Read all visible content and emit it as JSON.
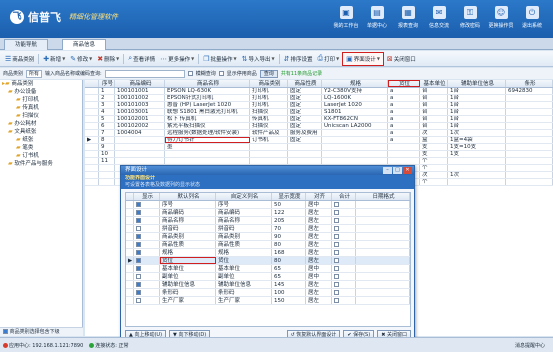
{
  "app": {
    "brand_name": "信普飞",
    "brand_sub": "精细化管理软件",
    "logo_char": "飞",
    "accent": "#1b5fae"
  },
  "topnav": [
    {
      "label": "我的工作台",
      "icon": "desktop-icon"
    },
    {
      "label": "单据中心",
      "icon": "document-icon"
    },
    {
      "label": "报表查询",
      "icon": "report-icon"
    },
    {
      "label": "信息交流",
      "icon": "chat-icon"
    },
    {
      "label": "修改密码",
      "icon": "key-icon"
    },
    {
      "label": "更换操作员",
      "icon": "user-switch-icon"
    },
    {
      "label": "退出系统",
      "icon": "power-icon"
    }
  ],
  "tabs": [
    "功能导航",
    "商品信息"
  ],
  "toolbar": [
    {
      "label": "商品类别",
      "icon": "category-icon"
    },
    {
      "label": "新增",
      "icon": "add-icon",
      "dropdown": true
    },
    {
      "label": "修改",
      "icon": "edit-icon",
      "dropdown": true
    },
    {
      "label": "删除",
      "icon": "delete-icon",
      "dropdown": true
    },
    {
      "label": "查看详情",
      "icon": "view-icon"
    },
    {
      "label": "更多操作",
      "icon": "more-icon",
      "dropdown": true
    },
    {
      "label": "批量操作",
      "icon": "batch-icon",
      "dropdown": true
    },
    {
      "label": "导入导出",
      "icon": "import-export-icon",
      "dropdown": true
    },
    {
      "label": "排序设置",
      "icon": "sort-icon"
    },
    {
      "label": "打印",
      "icon": "print-icon",
      "dropdown": true
    },
    {
      "label": "界面设计",
      "icon": "layout-design-icon",
      "dropdown": true,
      "highlight": true
    },
    {
      "label": "关闭窗口",
      "icon": "close-window-icon"
    }
  ],
  "filter": {
    "category_label": "商品类别",
    "category_value": "所有",
    "search_label": "输入商品名称或编码查询:",
    "search_value": "",
    "opt1": "模糊查询",
    "opt2": "显示停用商品",
    "query_btn": "查询",
    "tip": "共有11条商品记录"
  },
  "tree": [
    {
      "label": "商品类别",
      "level": 0
    },
    {
      "label": "办公设备",
      "level": 1
    },
    {
      "label": "打印机",
      "level": 2
    },
    {
      "label": "传真机",
      "level": 2
    },
    {
      "label": "扫描仪",
      "level": 2
    },
    {
      "label": "办公耗材",
      "level": 1
    },
    {
      "label": "文具纸张",
      "level": 1
    },
    {
      "label": "纸张",
      "level": 2
    },
    {
      "label": "笔类",
      "level": 2
    },
    {
      "label": "订书机",
      "level": 2
    },
    {
      "label": "软件产品与服务",
      "level": 1
    }
  ],
  "tree_footer": "商品类别选择包含下级",
  "grid": {
    "columns": [
      "序号",
      "商品编码",
      "商品名称",
      "商品类别",
      "商品性质",
      "规格",
      "货位",
      "基本单位",
      "辅助单位信息",
      "条形"
    ],
    "rows": [
      [
        "1",
        "100101001",
        "EPSON LQ-630K",
        "打印机",
        "固定",
        "Y2-C380V支持",
        "a",
        "台",
        "1台",
        "6942830"
      ],
      [
        "2",
        "100101002",
        "EPSON针式打印机",
        "打印机",
        "固定",
        "LQ-1600K",
        "a",
        "台",
        "1台",
        ""
      ],
      [
        "3",
        "100101003",
        "惠普 (HP) LaserJet 1020",
        "打印机",
        "固定",
        "LaserJet 1020",
        "a",
        "台",
        "1台",
        ""
      ],
      [
        "4",
        "100103001",
        "联想 S1801 黑白激光打印机",
        "扫描仪",
        "固定",
        "S1801",
        "a",
        "台",
        "1台",
        ""
      ],
      [
        "5",
        "100102001",
        "松下 传真机",
        "传真机",
        "固定",
        "KX-FT862CN",
        "a",
        "台",
        "1台",
        ""
      ],
      [
        "6",
        "100102002",
        "紫光平板扫描仪",
        "扫描仪",
        "固定",
        "Unicscan LA2000",
        "a",
        "台",
        "1台",
        ""
      ],
      [
        "7",
        "1004004",
        "远程服务(数据处理/软件安装)",
        "软件产品及",
        "服务及费用",
        "",
        "a",
        "次",
        "1次",
        ""
      ],
      [
        "8",
        "",
        "得力订书针",
        "订书机",
        "固定",
        "",
        "a",
        "盒",
        "1盒=4袋",
        ""
      ],
      [
        "9",
        "",
        "墨",
        "",
        "",
        "",
        "",
        "支",
        "1支=10支",
        ""
      ],
      [
        "10",
        "",
        "",
        "",
        "",
        "",
        "",
        "支",
        "1支",
        ""
      ],
      [
        "11",
        "",
        "",
        "",
        "",
        "",
        "",
        "个",
        "",
        ""
      ],
      [
        "",
        "",
        "",
        "",
        "",
        "",
        "",
        "个",
        "",
        ""
      ],
      [
        "",
        "",
        "",
        "",
        "",
        "",
        "",
        "次",
        "1次",
        ""
      ],
      [
        "",
        "",
        "",
        "",
        "",
        "",
        "",
        "个",
        "",
        ""
      ]
    ]
  },
  "dialog": {
    "title": "界面设计",
    "banner_title": "功能界面设计",
    "banner_sub": "可设置各表格及数据列的显示状态",
    "columns": [
      "显示",
      "默认列名",
      "自定义列名",
      "显示宽度",
      "对齐",
      "合计",
      "日期格式"
    ],
    "rows": [
      {
        "show": true,
        "name": "序号",
        "custom": "序号",
        "width": "50",
        "align": "居中",
        "sum": false
      },
      {
        "show": true,
        "name": "商品编码",
        "custom": "商品编码",
        "width": "122",
        "align": "居左",
        "sum": false
      },
      {
        "show": true,
        "name": "商品名称",
        "custom": "商品名称",
        "width": "205",
        "align": "居左",
        "sum": false
      },
      {
        "show": false,
        "name": "拼音码",
        "custom": "拼音码",
        "width": "70",
        "align": "居左",
        "sum": false
      },
      {
        "show": true,
        "name": "商品类别",
        "custom": "商品类别",
        "width": "90",
        "align": "居左",
        "sum": false
      },
      {
        "show": true,
        "name": "商品性质",
        "custom": "商品性质",
        "width": "80",
        "align": "居左",
        "sum": false
      },
      {
        "show": true,
        "name": "规格",
        "custom": "规格",
        "width": "168",
        "align": "居左",
        "sum": false
      },
      {
        "show": true,
        "name": "货位",
        "custom": "货位",
        "width": "80",
        "align": "居左",
        "sum": false,
        "highlight": true
      },
      {
        "show": true,
        "name": "基本单位",
        "custom": "基本单位",
        "width": "65",
        "align": "居中",
        "sum": false
      },
      {
        "show": false,
        "name": "副单位",
        "custom": "副单位",
        "width": "65",
        "align": "居中",
        "sum": false
      },
      {
        "show": true,
        "name": "辅助单位信息",
        "custom": "辅助单位信息",
        "width": "145",
        "align": "居左",
        "sum": false
      },
      {
        "show": true,
        "name": "条形码",
        "custom": "条形码",
        "width": "100",
        "align": "居左",
        "sum": false
      },
      {
        "show": false,
        "name": "生产厂家",
        "custom": "生产厂家",
        "width": "150",
        "align": "居左",
        "sum": false
      }
    ],
    "buttons": {
      "up": "向上移动(U)",
      "down": "向下移动(D)",
      "reset": "恢复默认界面设计",
      "save": "保存(S)",
      "close": "关闭窗口"
    }
  },
  "status": {
    "server": "应用中心: 192.168.1.121:7890",
    "connection": "连接状态: 正常",
    "right": "消息提醒中心"
  }
}
